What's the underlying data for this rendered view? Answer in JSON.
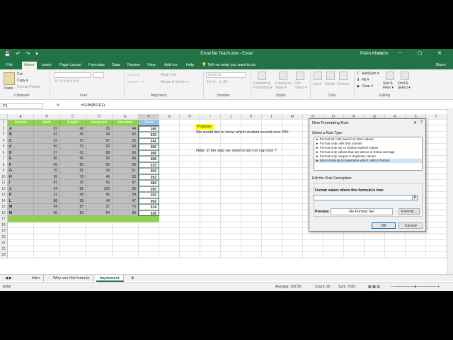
{
  "titlebar": {
    "qat": "💾 ↶ ↷ ▾",
    "title": "Excel file Teach.xlsx  -  Excel",
    "user": "Pokin Khemrin",
    "controls": "▭ ─ ▢ ✕"
  },
  "tabs": [
    {
      "label": "File"
    },
    {
      "label": "Home"
    },
    {
      "label": "Insert"
    },
    {
      "label": "Page Layout"
    },
    {
      "label": "Formulas"
    },
    {
      "label": "Data"
    },
    {
      "label": "Review"
    },
    {
      "label": "View"
    },
    {
      "label": "Add-ins"
    },
    {
      "label": "Help"
    }
  ],
  "tellme": "💡 Tell me what you want to do",
  "share": "Share",
  "ribbon": {
    "paste": "Paste",
    "cut": "Cut",
    "copy": "Copy ▾",
    "format_painter": "Format Painter",
    "clipboard": "Clipboard",
    "font": "Font",
    "alignment": "Alignment",
    "wrap_text": "Wrap Text",
    "merge_center": "Merge & Center ▾",
    "number_format": "General",
    "number": "Number",
    "conditional": "Conditional Formatting ▾",
    "format_table": "Format as Table ▾",
    "cell_styles": "Cell Styles ▾",
    "styles": "Styles",
    "insert": "Insert",
    "delete": "Delete",
    "format": "Format",
    "cells": "Cells",
    "autosum": "AutoSum ▾",
    "fill": "Fill ▾",
    "clear": "Clear ▾",
    "sort_filter": "Sort & Filter ▾",
    "find_select": "Find & Select ▾",
    "editing": "Editing"
  },
  "formula_bar": {
    "cell": "F2",
    "fx": "fx",
    "formula": "=SUM(B2:E2)"
  },
  "columns": [
    "A",
    "B",
    "C",
    "D",
    "E",
    "F",
    "G",
    "H",
    "I",
    "J",
    "K",
    "L",
    "M",
    "N",
    "O",
    "P",
    "Q",
    "R",
    "S",
    "T"
  ],
  "rows": [
    "1",
    "2",
    "3",
    "4",
    "5",
    "6",
    "7",
    "8",
    "9",
    "10",
    "11",
    "12",
    "13",
    "14",
    "15",
    "16",
    "17",
    "18",
    "19",
    "20",
    "21",
    "22",
    "23"
  ],
  "table": {
    "headers": [
      "Student",
      "Math",
      "English",
      "Assigment",
      "Attendent",
      "Score"
    ],
    "rows": [
      [
        "A",
        "82",
        "43",
        "35",
        "44",
        "195"
      ],
      [
        "B",
        "62",
        "45",
        "34",
        "92",
        "233"
      ],
      [
        "C",
        "52",
        "57",
        "97",
        "35",
        "241"
      ],
      [
        "d",
        "96",
        "33",
        "93",
        "68",
        "292"
      ],
      [
        "D",
        "57",
        "61",
        "88",
        "60",
        "266"
      ],
      [
        "E",
        "86",
        "96",
        "90",
        "84",
        "356"
      ],
      [
        "F",
        "49",
        "85",
        "56",
        "39",
        "233"
      ],
      [
        "G",
        "76",
        "91",
        "34",
        "51",
        "252"
      ],
      [
        "H",
        "95",
        "78",
        "46",
        "33",
        "252"
      ],
      [
        "I",
        "81",
        "30",
        "66",
        "97",
        "282"
      ],
      [
        "J",
        "34",
        "81",
        "100",
        "35",
        "250"
      ],
      [
        "K",
        "31",
        "42",
        "45",
        "34",
        "152"
      ],
      [
        "L",
        "88",
        "38",
        "49",
        "47",
        "202"
      ],
      [
        "M",
        "94",
        "87",
        "37",
        "76",
        "314"
      ],
      [
        "M",
        "90",
        "83",
        "64",
        "89",
        "326"
      ]
    ]
  },
  "notes": {
    "purpose": "Purpose:",
    "goal": "We would like to know which student scored over 250",
    "note": "Note: In the step we need to turn on cap lock !!"
  },
  "sheets": [
    {
      "label": "Intro"
    },
    {
      "label": "Why use this formula"
    },
    {
      "label": "Implement"
    }
  ],
  "statusbar": {
    "mode": "Enter",
    "average": "Average: 102.56",
    "count": "Count: 90",
    "sum": "Sum: 7692"
  },
  "dialog": {
    "title": "New Formatting Rule",
    "close": "✕",
    "help": "?",
    "select_type": "Select a Rule Type:",
    "rule_types": [
      "► Format all cells based on their values",
      "► Format only cells that contain",
      "► Format only top or bottom ranked values",
      "► Format only values that are above or below average",
      "► Format only unique or duplicate values",
      "► Use a formula to determine which cells to format"
    ],
    "edit_desc": "Edit the Rule Description:",
    "formula_label": "Format values where this formula is true:",
    "formula_value": "",
    "preview_label": "Preview:",
    "preview_text": "No Format Set",
    "format_button": "Format...",
    "ok": "OK",
    "cancel": "Cancel"
  }
}
